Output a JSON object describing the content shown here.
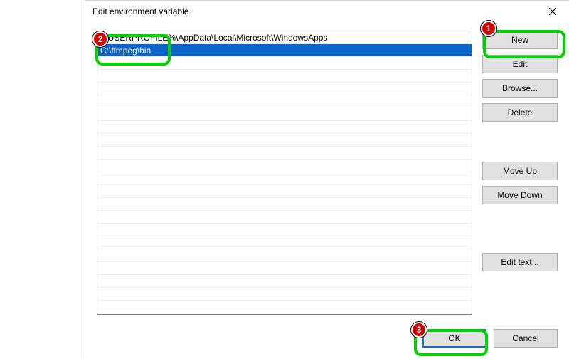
{
  "title": "Edit environment variable",
  "rows": [
    "%USERPROFILE%\\AppData\\Local\\Microsoft\\WindowsApps",
    "C:\\ffmpeg\\bin"
  ],
  "selectedIndex": 1,
  "buttons": {
    "new": "New",
    "edit": "Edit",
    "browse": "Browse...",
    "delete": "Delete",
    "moveup": "Move Up",
    "movedown": "Move Down",
    "edittext": "Edit text..."
  },
  "footer": {
    "ok": "OK",
    "cancel": "Cancel"
  },
  "callouts": {
    "1": "1",
    "2": "2",
    "3": "3"
  }
}
